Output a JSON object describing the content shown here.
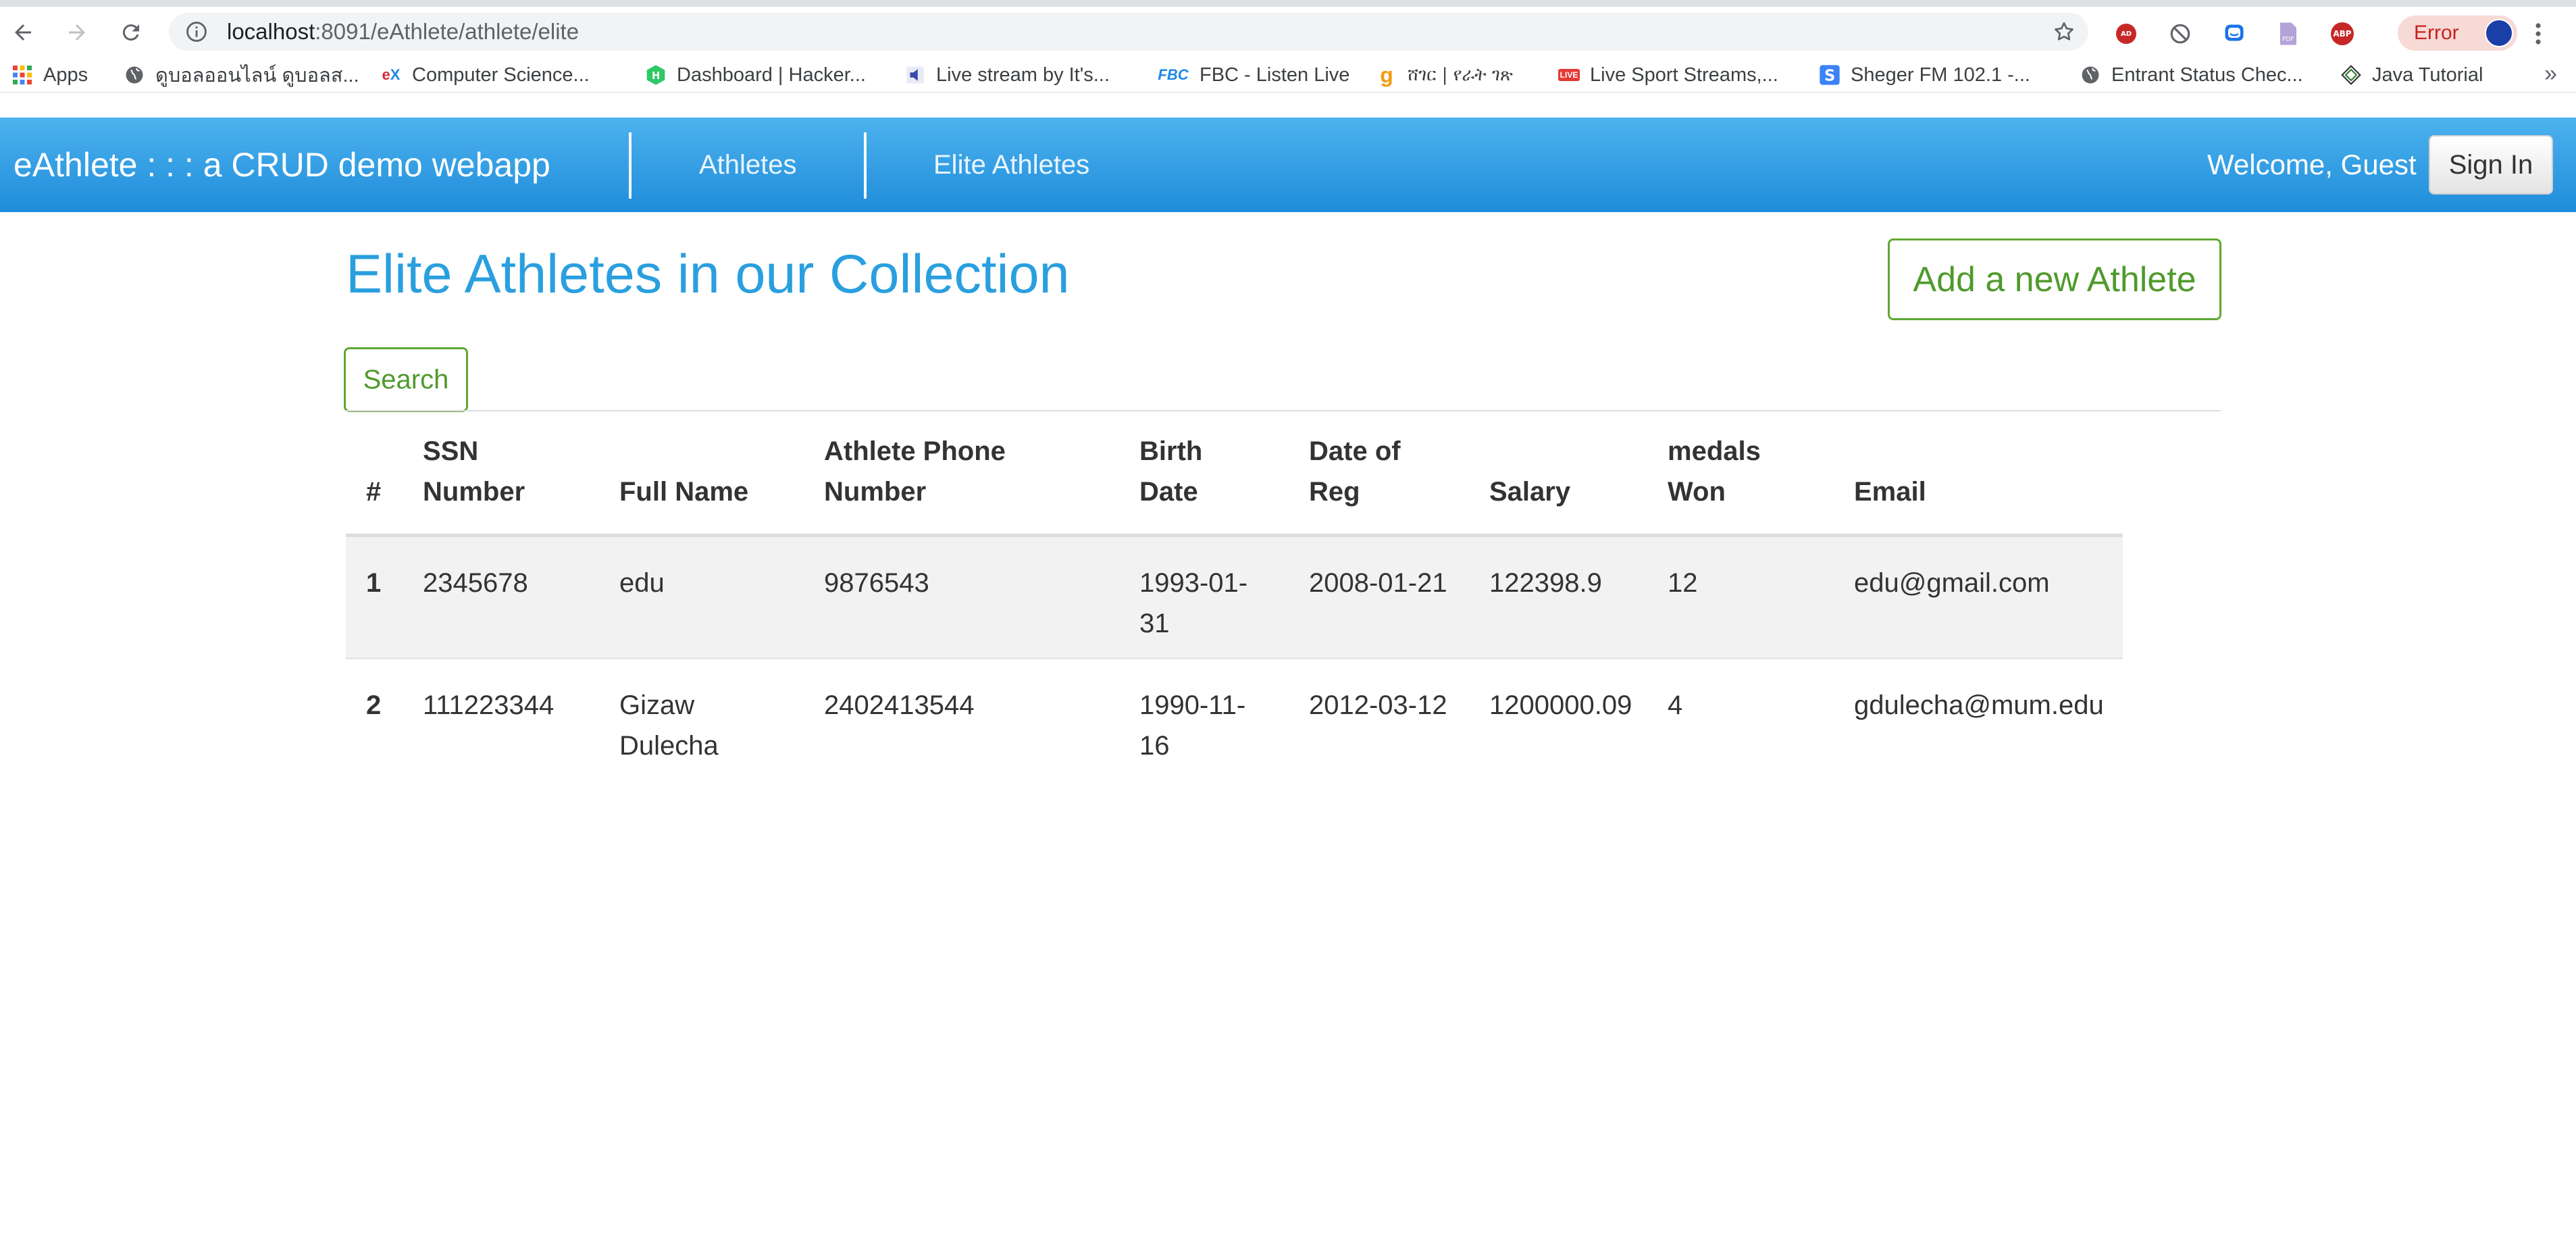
{
  "browser": {
    "url_host": "localhost",
    "url_rest": ":8091/eAthlete/athlete/elite",
    "error_label": "Error",
    "bookmarks": [
      {
        "label": "Apps",
        "icon": "apps-grid-icon"
      },
      {
        "label": "ดูบอลออนไลน์ ดูบอลส...",
        "icon": "globe-icon"
      },
      {
        "label": "Computer Science...",
        "icon": "edx-icon"
      },
      {
        "label": "Dashboard | Hacker...",
        "icon": "hackerrank-icon"
      },
      {
        "label": "Live stream by It's...",
        "icon": "speaker-icon"
      },
      {
        "label": "FBC - Listen Live",
        "icon": "fbc-icon"
      },
      {
        "label": "ሸገር | የራት ገጽ",
        "icon": "sheger-g-icon"
      },
      {
        "label": "Live Sport Streams,...",
        "icon": "live-icon"
      },
      {
        "label": "Sheger FM 102.1 -...",
        "icon": "s-icon"
      },
      {
        "label": "Entrant Status Chec...",
        "icon": "globe-icon"
      },
      {
        "label": "Java Tutorial",
        "icon": "java-icon"
      }
    ],
    "more_label": "»"
  },
  "navbar": {
    "brand": "eAthlete : : : a CRUD demo webapp",
    "links": [
      "Athletes",
      "Elite Athletes"
    ],
    "welcome": "Welcome, Guest",
    "signin": "Sign In"
  },
  "main": {
    "title": "Elite Athletes in our Collection",
    "add_button": "Add a new Athlete",
    "search_button": "Search",
    "table": {
      "headers": [
        [
          "#"
        ],
        [
          "SSN",
          "Number"
        ],
        [
          "Full Name"
        ],
        [
          "Athlete Phone",
          "Number"
        ],
        [
          "Birth",
          "Date"
        ],
        [
          "Date of",
          "Reg"
        ],
        [
          "Salary"
        ],
        [
          "medals",
          "Won"
        ],
        [
          "Email"
        ]
      ],
      "rows": [
        {
          "idx": "1",
          "ssn": "2345678",
          "name": [
            "edu"
          ],
          "phone": "9876543",
          "birth": [
            "1993-01-",
            "31"
          ],
          "reg": "2008-01-21",
          "salary": "122398.9",
          "medals": "12",
          "email": "edu@gmail.com"
        },
        {
          "idx": "2",
          "ssn": "111223344",
          "name": [
            "Gizaw",
            "Dulecha"
          ],
          "phone": "2402413544",
          "birth": [
            "1990-11-",
            "16"
          ],
          "reg": "2012-03-12",
          "salary": "1200000.09",
          "medals": "4",
          "email": "gdulecha@mum.edu"
        }
      ]
    }
  },
  "colors": {
    "navbar_top": "#4db2ee",
    "navbar_bottom": "#1f8ddb",
    "title": "#2a9fdf",
    "success_outline": "#5fa832",
    "stripe": "#f2f2f2"
  }
}
